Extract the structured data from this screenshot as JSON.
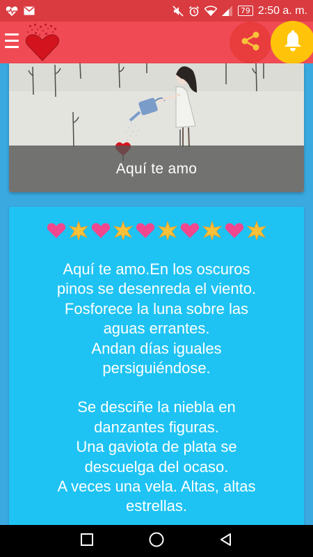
{
  "status_bar": {
    "time": "2:50 a. m.",
    "battery": "79",
    "icons": [
      "heart-pulse-icon",
      "gmail-icon",
      "mute-icon",
      "alarm-icon",
      "wifi-icon",
      "signal-icon",
      "battery-icon"
    ]
  },
  "app_bar": {
    "menu_icon": "hamburger-menu-icon",
    "logo": "heart-logo",
    "share_icon": "share-icon",
    "bell_icon": "bell-icon",
    "colors": {
      "status": "#d93b40",
      "bar": "#f04b55",
      "share": "#e83c3d",
      "bell": "#ffc40a"
    }
  },
  "image_card": {
    "caption": "Aquí te amo"
  },
  "poem_card": {
    "decoration": [
      "heart",
      "star",
      "heart",
      "star",
      "heart",
      "star",
      "heart",
      "star",
      "heart",
      "star"
    ],
    "stanzas": [
      [
        "Aquí te amo.En los oscuros",
        "pinos se desenreda el viento.",
        "Fosforece la luna sobre las",
        "aguas errantes.",
        "Andan días iguales",
        "persiguiéndose."
      ],
      [
        "Se desciñe la niebla en",
        "danzantes figuras.",
        "Una gaviota de plata se",
        "descuelga del ocaso.",
        "A veces una vela. Altas, altas",
        "estrellas."
      ]
    ],
    "colors": {
      "card": "#1ec3f3",
      "background": "#3aa9e0",
      "heart": "#f0478f",
      "star": "#f7c23a"
    }
  },
  "nav_bar": {
    "buttons": [
      "recent-apps-icon",
      "home-icon",
      "back-icon"
    ]
  }
}
